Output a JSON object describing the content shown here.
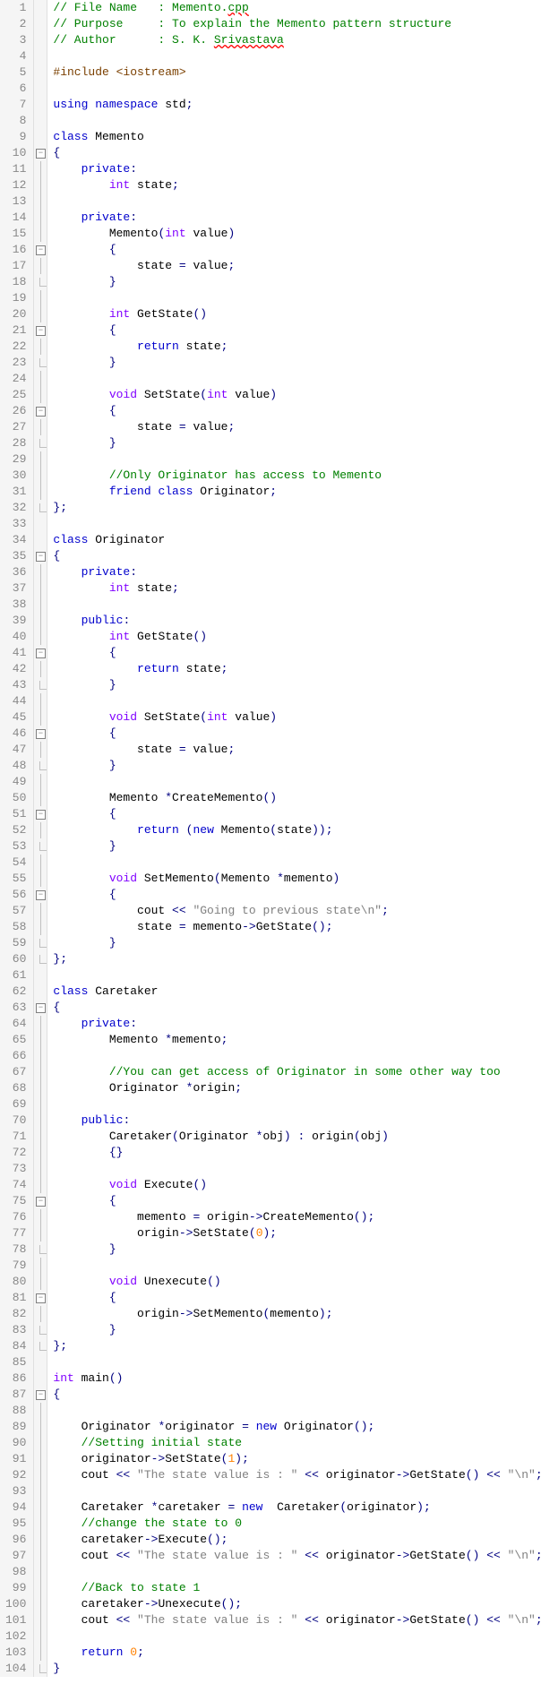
{
  "lines": [
    {
      "n": 1,
      "f": "",
      "h": "<span class='cmt'>// File Name   : Memento.<span class='err'>cpp</span></span>"
    },
    {
      "n": 2,
      "f": "",
      "h": "<span class='cmt'>// Purpose     : To explain the Memento pattern structure</span>"
    },
    {
      "n": 3,
      "f": "",
      "h": "<span class='cmt'>// Author      : S. K. <span class='err'>Srivastava</span></span>"
    },
    {
      "n": 4,
      "f": "",
      "h": ""
    },
    {
      "n": 5,
      "f": "",
      "h": "<span class='pp'>#include &lt;iostream&gt;</span>"
    },
    {
      "n": 6,
      "f": "",
      "h": ""
    },
    {
      "n": 7,
      "f": "",
      "h": "<span class='kw'>using</span> <span class='kw'>namespace</span> std<span class='op'>;</span>"
    },
    {
      "n": 8,
      "f": "",
      "h": ""
    },
    {
      "n": 9,
      "f": "",
      "h": "<span class='kw'>class</span> Memento"
    },
    {
      "n": 10,
      "f": "box",
      "h": "<span class='op'>{</span>"
    },
    {
      "n": 11,
      "f": "bar",
      "h": "    <span class='kw'>private</span><span class='op'>:</span>"
    },
    {
      "n": 12,
      "f": "bar",
      "h": "        <span class='type'>int</span> state<span class='op'>;</span>"
    },
    {
      "n": 13,
      "f": "bar",
      "h": ""
    },
    {
      "n": 14,
      "f": "bar",
      "h": "    <span class='kw'>private</span><span class='op'>:</span>"
    },
    {
      "n": 15,
      "f": "bar",
      "h": "        Memento<span class='op'>(</span><span class='type'>int</span> value<span class='op'>)</span>"
    },
    {
      "n": 16,
      "f": "box",
      "h": "        <span class='op'>{</span>"
    },
    {
      "n": 17,
      "f": "bar",
      "h": "            state <span class='op'>=</span> value<span class='op'>;</span>"
    },
    {
      "n": 18,
      "f": "end",
      "h": "        <span class='op'>}</span>"
    },
    {
      "n": 19,
      "f": "bar",
      "h": ""
    },
    {
      "n": 20,
      "f": "bar",
      "h": "        <span class='type'>int</span> GetState<span class='op'>()</span>"
    },
    {
      "n": 21,
      "f": "box",
      "h": "        <span class='op'>{</span>"
    },
    {
      "n": 22,
      "f": "bar",
      "h": "            <span class='kw'>return</span> state<span class='op'>;</span>"
    },
    {
      "n": 23,
      "f": "end",
      "h": "        <span class='op'>}</span>"
    },
    {
      "n": 24,
      "f": "bar",
      "h": ""
    },
    {
      "n": 25,
      "f": "bar",
      "h": "        <span class='type'>void</span> SetState<span class='op'>(</span><span class='type'>int</span> value<span class='op'>)</span>"
    },
    {
      "n": 26,
      "f": "box",
      "h": "        <span class='op'>{</span>"
    },
    {
      "n": 27,
      "f": "bar",
      "h": "            state <span class='op'>=</span> value<span class='op'>;</span>"
    },
    {
      "n": 28,
      "f": "end",
      "h": "        <span class='op'>}</span>"
    },
    {
      "n": 29,
      "f": "bar",
      "h": ""
    },
    {
      "n": 30,
      "f": "bar",
      "h": "        <span class='cmt'>//Only Originator has access to Memento</span>"
    },
    {
      "n": 31,
      "f": "bar",
      "h": "        <span class='kw'>friend</span> <span class='kw'>class</span> Originator<span class='op'>;</span>"
    },
    {
      "n": 32,
      "f": "end",
      "h": "<span class='op'>};</span>"
    },
    {
      "n": 33,
      "f": "",
      "h": ""
    },
    {
      "n": 34,
      "f": "",
      "h": "<span class='kw'>class</span> Originator"
    },
    {
      "n": 35,
      "f": "box",
      "h": "<span class='op'>{</span>"
    },
    {
      "n": 36,
      "f": "bar",
      "h": "    <span class='kw'>private</span><span class='op'>:</span>"
    },
    {
      "n": 37,
      "f": "bar",
      "h": "        <span class='type'>int</span> state<span class='op'>;</span>"
    },
    {
      "n": 38,
      "f": "bar",
      "h": ""
    },
    {
      "n": 39,
      "f": "bar",
      "h": "    <span class='kw'>public</span><span class='op'>:</span>"
    },
    {
      "n": 40,
      "f": "bar",
      "h": "        <span class='type'>int</span> GetState<span class='op'>()</span>"
    },
    {
      "n": 41,
      "f": "box",
      "h": "        <span class='op'>{</span>"
    },
    {
      "n": 42,
      "f": "bar",
      "h": "            <span class='kw'>return</span> state<span class='op'>;</span>"
    },
    {
      "n": 43,
      "f": "end",
      "h": "        <span class='op'>}</span>"
    },
    {
      "n": 44,
      "f": "bar",
      "h": ""
    },
    {
      "n": 45,
      "f": "bar",
      "h": "        <span class='type'>void</span> SetState<span class='op'>(</span><span class='type'>int</span> value<span class='op'>)</span>"
    },
    {
      "n": 46,
      "f": "box",
      "h": "        <span class='op'>{</span>"
    },
    {
      "n": 47,
      "f": "bar",
      "h": "            state <span class='op'>=</span> value<span class='op'>;</span>"
    },
    {
      "n": 48,
      "f": "end",
      "h": "        <span class='op'>}</span>"
    },
    {
      "n": 49,
      "f": "bar",
      "h": ""
    },
    {
      "n": 50,
      "f": "bar",
      "h": "        Memento <span class='op'>*</span>CreateMemento<span class='op'>()</span>"
    },
    {
      "n": 51,
      "f": "box",
      "h": "        <span class='op'>{</span>"
    },
    {
      "n": 52,
      "f": "bar",
      "h": "            <span class='kw'>return</span> <span class='op'>(</span><span class='kw'>new</span> Memento<span class='op'>(</span>state<span class='op'>));</span>"
    },
    {
      "n": 53,
      "f": "end",
      "h": "        <span class='op'>}</span>"
    },
    {
      "n": 54,
      "f": "bar",
      "h": ""
    },
    {
      "n": 55,
      "f": "bar",
      "h": "        <span class='type'>void</span> SetMemento<span class='op'>(</span>Memento <span class='op'>*</span>memento<span class='op'>)</span>"
    },
    {
      "n": 56,
      "f": "box",
      "h": "        <span class='op'>{</span>"
    },
    {
      "n": 57,
      "f": "bar",
      "h": "            cout <span class='op'>&lt;&lt;</span> <span class='str'>\"Going to previous state\\n\"</span><span class='op'>;</span>"
    },
    {
      "n": 58,
      "f": "bar",
      "h": "            state <span class='op'>=</span> memento<span class='op'>-&gt;</span>GetState<span class='op'>();</span>"
    },
    {
      "n": 59,
      "f": "end",
      "h": "        <span class='op'>}</span>"
    },
    {
      "n": 60,
      "f": "end",
      "h": "<span class='op'>};</span>"
    },
    {
      "n": 61,
      "f": "",
      "h": ""
    },
    {
      "n": 62,
      "f": "",
      "h": "<span class='kw'>class</span> Caretaker"
    },
    {
      "n": 63,
      "f": "box",
      "h": "<span class='op'>{</span>"
    },
    {
      "n": 64,
      "f": "bar",
      "h": "    <span class='kw'>private</span><span class='op'>:</span>"
    },
    {
      "n": 65,
      "f": "bar",
      "h": "        Memento <span class='op'>*</span>memento<span class='op'>;</span>"
    },
    {
      "n": 66,
      "f": "bar",
      "h": ""
    },
    {
      "n": 67,
      "f": "bar",
      "h": "        <span class='cmt'>//You can get access of Originator in some other way too</span>"
    },
    {
      "n": 68,
      "f": "bar",
      "h": "        Originator <span class='op'>*</span>origin<span class='op'>;</span>"
    },
    {
      "n": 69,
      "f": "bar",
      "h": ""
    },
    {
      "n": 70,
      "f": "bar",
      "h": "    <span class='kw'>public</span><span class='op'>:</span>"
    },
    {
      "n": 71,
      "f": "bar",
      "h": "        Caretaker<span class='op'>(</span>Originator <span class='op'>*</span>obj<span class='op'>)</span> <span class='op'>:</span> origin<span class='op'>(</span>obj<span class='op'>)</span>"
    },
    {
      "n": 72,
      "f": "bar",
      "h": "        <span class='op'>{}</span>"
    },
    {
      "n": 73,
      "f": "bar",
      "h": ""
    },
    {
      "n": 74,
      "f": "bar",
      "h": "        <span class='type'>void</span> Execute<span class='op'>()</span>"
    },
    {
      "n": 75,
      "f": "box",
      "h": "        <span class='op'>{</span>"
    },
    {
      "n": 76,
      "f": "bar",
      "h": "            memento <span class='op'>=</span> origin<span class='op'>-&gt;</span>CreateMemento<span class='op'>();</span>"
    },
    {
      "n": 77,
      "f": "bar",
      "h": "            origin<span class='op'>-&gt;</span>SetState<span class='op'>(</span><span class='num'>0</span><span class='op'>);</span>"
    },
    {
      "n": 78,
      "f": "end",
      "h": "        <span class='op'>}</span>"
    },
    {
      "n": 79,
      "f": "bar",
      "h": ""
    },
    {
      "n": 80,
      "f": "bar",
      "h": "        <span class='type'>void</span> Unexecute<span class='op'>()</span>"
    },
    {
      "n": 81,
      "f": "box",
      "h": "        <span class='op'>{</span>"
    },
    {
      "n": 82,
      "f": "bar",
      "h": "            origin<span class='op'>-&gt;</span>SetMemento<span class='op'>(</span>memento<span class='op'>);</span>"
    },
    {
      "n": 83,
      "f": "end",
      "h": "        <span class='op'>}</span>"
    },
    {
      "n": 84,
      "f": "end",
      "h": "<span class='op'>};</span>"
    },
    {
      "n": 85,
      "f": "",
      "h": ""
    },
    {
      "n": 86,
      "f": "",
      "h": "<span class='type'>int</span> main<span class='op'>()</span>"
    },
    {
      "n": 87,
      "f": "box",
      "h": "<span class='op'>{</span>"
    },
    {
      "n": 88,
      "f": "bar",
      "h": ""
    },
    {
      "n": 89,
      "f": "bar",
      "h": "    Originator <span class='op'>*</span>originator <span class='op'>=</span> <span class='kw'>new</span> Originator<span class='op'>();</span>"
    },
    {
      "n": 90,
      "f": "bar",
      "h": "    <span class='cmt'>//Setting initial state</span>"
    },
    {
      "n": 91,
      "f": "bar",
      "h": "    originator<span class='op'>-&gt;</span>SetState<span class='op'>(</span><span class='num'>1</span><span class='op'>);</span>"
    },
    {
      "n": 92,
      "f": "bar",
      "h": "    cout <span class='op'>&lt;&lt;</span> <span class='str'>\"The state value is : \"</span> <span class='op'>&lt;&lt;</span> originator<span class='op'>-&gt;</span>GetState<span class='op'>()</span> <span class='op'>&lt;&lt;</span> <span class='str'>\"\\n\"</span><span class='op'>;</span>"
    },
    {
      "n": 93,
      "f": "bar",
      "h": ""
    },
    {
      "n": 94,
      "f": "bar",
      "h": "    Caretaker <span class='op'>*</span>caretaker <span class='op'>=</span> <span class='kw'>new</span>  Caretaker<span class='op'>(</span>originator<span class='op'>);</span>"
    },
    {
      "n": 95,
      "f": "bar",
      "h": "    <span class='cmt'>//change the state to 0</span>"
    },
    {
      "n": 96,
      "f": "bar",
      "h": "    caretaker<span class='op'>-&gt;</span>Execute<span class='op'>();</span>"
    },
    {
      "n": 97,
      "f": "bar",
      "h": "    cout <span class='op'>&lt;&lt;</span> <span class='str'>\"The state value is : \"</span> <span class='op'>&lt;&lt;</span> originator<span class='op'>-&gt;</span>GetState<span class='op'>()</span> <span class='op'>&lt;&lt;</span> <span class='str'>\"\\n\"</span><span class='op'>;</span>"
    },
    {
      "n": 98,
      "f": "bar",
      "h": ""
    },
    {
      "n": 99,
      "f": "bar",
      "h": "    <span class='cmt'>//Back to state 1</span>"
    },
    {
      "n": 100,
      "f": "bar",
      "h": "    caretaker<span class='op'>-&gt;</span>Unexecute<span class='op'>();</span>"
    },
    {
      "n": 101,
      "f": "bar",
      "h": "    cout <span class='op'>&lt;&lt;</span> <span class='str'>\"The state value is : \"</span> <span class='op'>&lt;&lt;</span> originator<span class='op'>-&gt;</span>GetState<span class='op'>()</span> <span class='op'>&lt;&lt;</span> <span class='str'>\"\\n\"</span><span class='op'>;</span>"
    },
    {
      "n": 102,
      "f": "bar",
      "h": ""
    },
    {
      "n": 103,
      "f": "bar",
      "h": "    <span class='kw'>return</span> <span class='num'>0</span><span class='op'>;</span>"
    },
    {
      "n": 104,
      "f": "end",
      "h": "<span class='op'>}</span>"
    }
  ]
}
